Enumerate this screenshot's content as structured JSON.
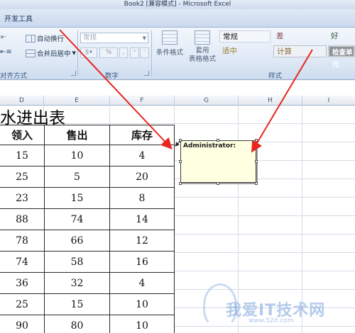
{
  "window": {
    "title": "Book2  [兼容模式] - Microsoft Excel"
  },
  "ribbon": {
    "tab": "开发工具",
    "alignment": {
      "wrap_text": "自动换行",
      "merge_center": "合并后居中",
      "group_label": "对齐方式"
    },
    "number": {
      "format_value": "常规",
      "percent": "%",
      "comma": ",",
      "group_label": "数字"
    },
    "styles": {
      "conditional_format": "条件格式",
      "apply_table_format_1": "套用",
      "apply_table_format_2": "表格格式",
      "cell_styles": [
        {
          "label": "常规",
          "bg": "#ffffff"
        },
        {
          "label": "差",
          "bg": "#ffc7ce"
        },
        {
          "label": "好",
          "bg": "#c6efce"
        },
        {
          "label": "适中",
          "bg": "#ffeb9c"
        },
        {
          "label": "计算",
          "bg": "#f2f2f2"
        },
        {
          "label": "检查单元",
          "bg": "#a5a5a5"
        }
      ],
      "group_label": "样式"
    }
  },
  "columns": [
    "D",
    "E",
    "F",
    "G",
    "H",
    "I"
  ],
  "sheet": {
    "title": "水进出表",
    "headers": [
      "领入",
      "售出",
      "库存"
    ],
    "rows": [
      [
        "15",
        "10",
        "4"
      ],
      [
        "25",
        "5",
        "20"
      ],
      [
        "23",
        "15",
        "8"
      ],
      [
        "88",
        "74",
        "14"
      ],
      [
        "78",
        "66",
        "12"
      ],
      [
        "74",
        "58",
        "16"
      ],
      [
        "36",
        "32",
        "4"
      ],
      [
        "25",
        "15",
        "10"
      ],
      [
        "90",
        "80",
        "10"
      ]
    ]
  },
  "comment": {
    "author": "Administrator:"
  },
  "watermark": {
    "text": "我爱IT技术网",
    "url": "www.52it.com"
  },
  "colors": {
    "arrow": "#e8261e",
    "comment_bg": "#ffffe1"
  }
}
